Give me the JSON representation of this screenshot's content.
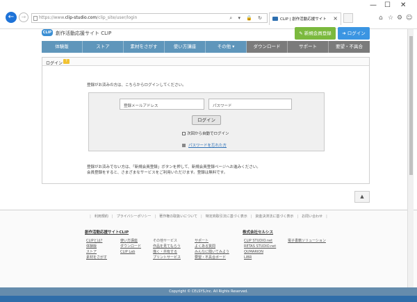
{
  "browser": {
    "url_prefix": "https://www.",
    "url_domain": "clip-studio.com",
    "url_path": "/clip_site/user/login",
    "address_icons": "⌕ ▾ 🔒 ↻",
    "tab_title": "CLIP | 創作活動応援サイト",
    "tab_close": "×",
    "win_minimize": "—",
    "win_maximize": "☐",
    "win_close": "✕",
    "tool_home": "⌂",
    "tool_star": "☆",
    "tool_gear": "⚙",
    "tool_smile": "☺"
  },
  "header": {
    "logo": "CLIP",
    "site_title": "創作活動応援サイト CLIP",
    "register_button": "新規会員登録",
    "login_button": "ログイン"
  },
  "nav": [
    {
      "label": "体験版",
      "style": "blue"
    },
    {
      "label": "ストア",
      "style": "blue"
    },
    {
      "label": "素材をさがす",
      "style": "blue"
    },
    {
      "label": "使い方講座",
      "style": "blue"
    },
    {
      "label": "その他 ▾",
      "style": "blue"
    },
    {
      "label": "ダウンロード",
      "style": "grey"
    },
    {
      "label": "サポート",
      "style": "grey"
    },
    {
      "label": "要望・不具合",
      "style": "grey"
    }
  ],
  "login": {
    "heading": "ログイン",
    "help_badge": "?",
    "intro": "登録がお済みの方は、こちらからログインしてください。",
    "email_placeholder": "登録メールアドレス",
    "password_placeholder": "パスワード",
    "login_button": "ログイン",
    "auto_login": "次回から自動でログイン",
    "forgot_password": "パスワードを忘れた方",
    "note_line1": "登録がお済みでない方は、「新規会員登録」ボタンを押して、新規会員登録ページへお進みください。",
    "note_line2": "会員登録をすると、さまざまなサービスをご利用いただけます。登録は無料です。"
  },
  "page_top": "▲",
  "footer": {
    "links": [
      "利用規約",
      "プライバシーポリシー",
      "著作権の取扱いについて",
      "特定商取引法に基づく表示",
      "資金決済法に基づく表示",
      "お問い合わせ"
    ],
    "section1_title": "創作活動応援サイトCLIP",
    "section2_title": "株式会社セルシス",
    "col1": [
      "CLIPとは?",
      "体験版",
      "ストア",
      "素材をさがす"
    ],
    "col2": [
      "使い方講座",
      "ダウンロード",
      "CLIP Lab"
    ],
    "col3_head": "その他サービス",
    "col3": [
      "作品を見てもらう",
      "描く・共有する",
      "プリントサービス"
    ],
    "col4": [
      "サポート",
      "よくある質問",
      "みんなに聞いてみよう",
      "要望・不具合ボード"
    ],
    "col5": [
      "CLIP STUDIO.net",
      "RETAS STUDIO.net",
      "QUMARION",
      "LIBR"
    ],
    "col6": [
      "電子書籍ソリューション"
    ],
    "copyright": "Copyright © CELSYS,Inc. All Rights Reserved."
  }
}
